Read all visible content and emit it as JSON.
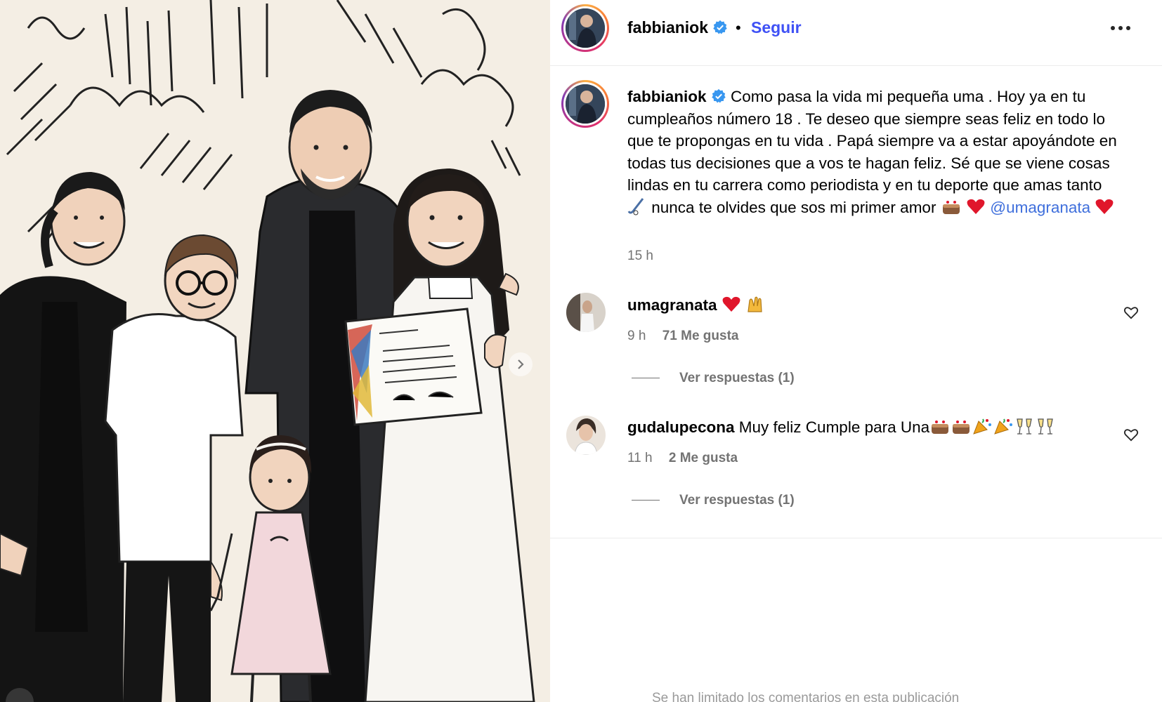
{
  "header": {
    "username": "fabbianiok",
    "separator": "•",
    "follow_label": "Seguir",
    "more_icon": "more-horizontal-icon"
  },
  "post": {
    "username": "fabbianiok",
    "caption_1": "Como pasa la vida mi pequeña uma . Hoy ya en tu cumpleaños número 18 . Te deseo que siempre seas feliz en todo lo que te propongas en tu vida . Papá siempre va a estar apoyándote en todas tus decisiones que a vos te hagan feliz. Sé que se viene cosas lindas en tu carrera como periodista y en tu deporte que amas tanto",
    "caption_2": "nunca te olvides que sos mi primer amor",
    "mention": "@umagranata",
    "time": "15 h"
  },
  "comments": [
    {
      "username": "umagranata",
      "text": "",
      "time": "9 h",
      "likes": "71 Me gusta",
      "replies": "Ver respuestas (1)"
    },
    {
      "username": "gudalupecona",
      "text": "Muy feliz Cumple para Una",
      "time": "11 h",
      "likes": "2 Me gusta",
      "replies": "Ver respuestas (1)"
    }
  ],
  "footer": {
    "limited_text": "Se han limitado los comentarios en esta publicación"
  },
  "colors": {
    "accent": "#3f51f5",
    "mention": "#3f6fdc",
    "muted": "#737373",
    "verified": "#3897f0",
    "heart": "#e0162b"
  }
}
